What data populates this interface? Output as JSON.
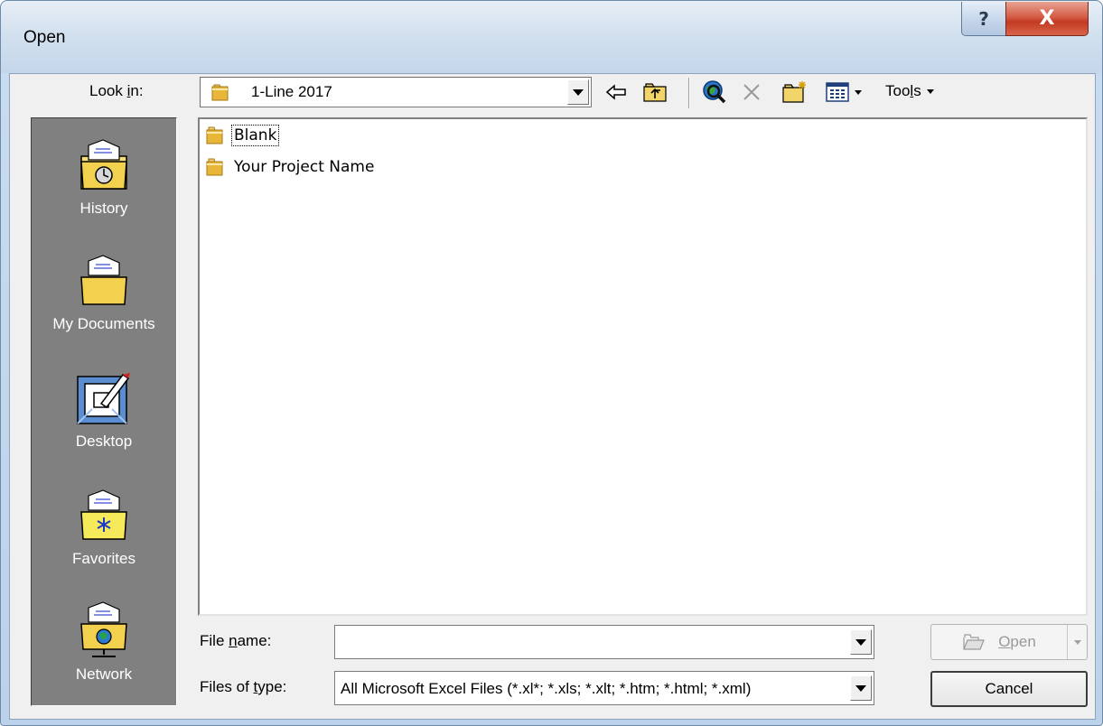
{
  "window": {
    "title": "Open",
    "help_glyph": "?",
    "close_glyph": "X"
  },
  "toolbar": {
    "look_in_label_pre": "Look ",
    "look_in_label_u": "i",
    "look_in_label_post": "n:",
    "look_in_value": "1-Line 2017",
    "icons": [
      "back-icon",
      "up-one-level-icon",
      "search-web-icon",
      "delete-icon",
      "create-new-folder-icon",
      "views-icon"
    ],
    "tools_label_pre": "Too",
    "tools_label_u": "l",
    "tools_label_post": "s"
  },
  "places": [
    {
      "label": "History",
      "icon": "history-icon"
    },
    {
      "label": "My Documents",
      "icon": "my-documents-icon"
    },
    {
      "label": "Desktop",
      "icon": "desktop-icon"
    },
    {
      "label": "Favorites",
      "icon": "favorites-icon"
    },
    {
      "label": "Network",
      "icon": "network-icon"
    }
  ],
  "files": [
    {
      "name": "Blank",
      "type": "folder",
      "focused": true
    },
    {
      "name": "Your Project Name",
      "type": "folder",
      "focused": false
    }
  ],
  "file_name": {
    "label_pre": "File ",
    "label_u": "n",
    "label_post": "ame:",
    "value": ""
  },
  "files_of_type": {
    "label_pre": "Files of ",
    "label_u": "t",
    "label_post": "ype:",
    "value": "All Microsoft Excel Files (*.xl*; *.xls; *.xlt; *.htm; *.html; *.xml)"
  },
  "buttons": {
    "open_label_u": "O",
    "open_label_post": "pen",
    "cancel_label": "Cancel"
  },
  "colors": {
    "places_bg": "#808080",
    "folder_yellow": "#f4d060",
    "close_red": "#c23b21"
  }
}
